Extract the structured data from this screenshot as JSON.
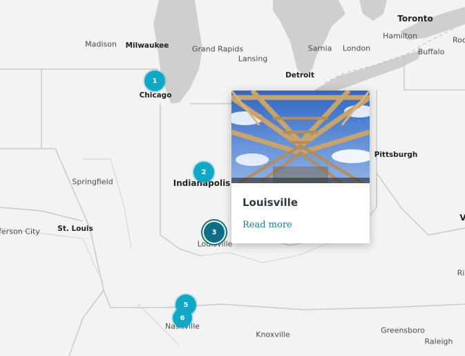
{
  "map": {
    "labels": [
      {
        "text": "Toronto",
        "style": "xl"
      },
      {
        "text": "Hamilton",
        "style": "normal"
      },
      {
        "text": "Buffalo",
        "style": "normal"
      },
      {
        "text": "Roc",
        "style": "normal"
      },
      {
        "text": "Madison",
        "style": "normal"
      },
      {
        "text": "Milwaukee",
        "style": "big"
      },
      {
        "text": "Grand Rapids",
        "style": "normal"
      },
      {
        "text": "Lansing",
        "style": "normal"
      },
      {
        "text": "Sarnia",
        "style": "normal"
      },
      {
        "text": "London",
        "style": "normal"
      },
      {
        "text": "Detroit",
        "style": "big"
      },
      {
        "text": "Chicago",
        "style": "big"
      },
      {
        "text": "Pittsburgh",
        "style": "big"
      },
      {
        "text": "Springfield",
        "style": "normal"
      },
      {
        "text": "Indianapolis",
        "style": "xl"
      },
      {
        "text": "ferson City",
        "style": "normal"
      },
      {
        "text": "St. Louis",
        "style": "big"
      },
      {
        "text": "Louisville",
        "style": "normal"
      },
      {
        "text": "Ri",
        "style": "normal"
      },
      {
        "text": "Nashville",
        "style": "normal"
      },
      {
        "text": "Knoxville",
        "style": "normal"
      },
      {
        "text": "Greensboro",
        "style": "normal"
      },
      {
        "text": "Raleigh",
        "style": "normal"
      },
      {
        "text": "V",
        "style": "xl"
      }
    ],
    "markers": [
      {
        "count": "1",
        "active": false
      },
      {
        "count": "2",
        "active": false
      },
      {
        "count": "3",
        "active": true
      },
      {
        "count": "6",
        "active": false
      },
      {
        "count": "5",
        "active": false
      }
    ]
  },
  "popup": {
    "title": "Louisville",
    "read_more": "Read more"
  },
  "colors": {
    "water": "#cfcfcf",
    "land": "#f3f3f3",
    "border": "#c9c9c9",
    "marker": "#11a8c6",
    "marker_active": "#0c6f86",
    "link": "#1a7f94"
  }
}
